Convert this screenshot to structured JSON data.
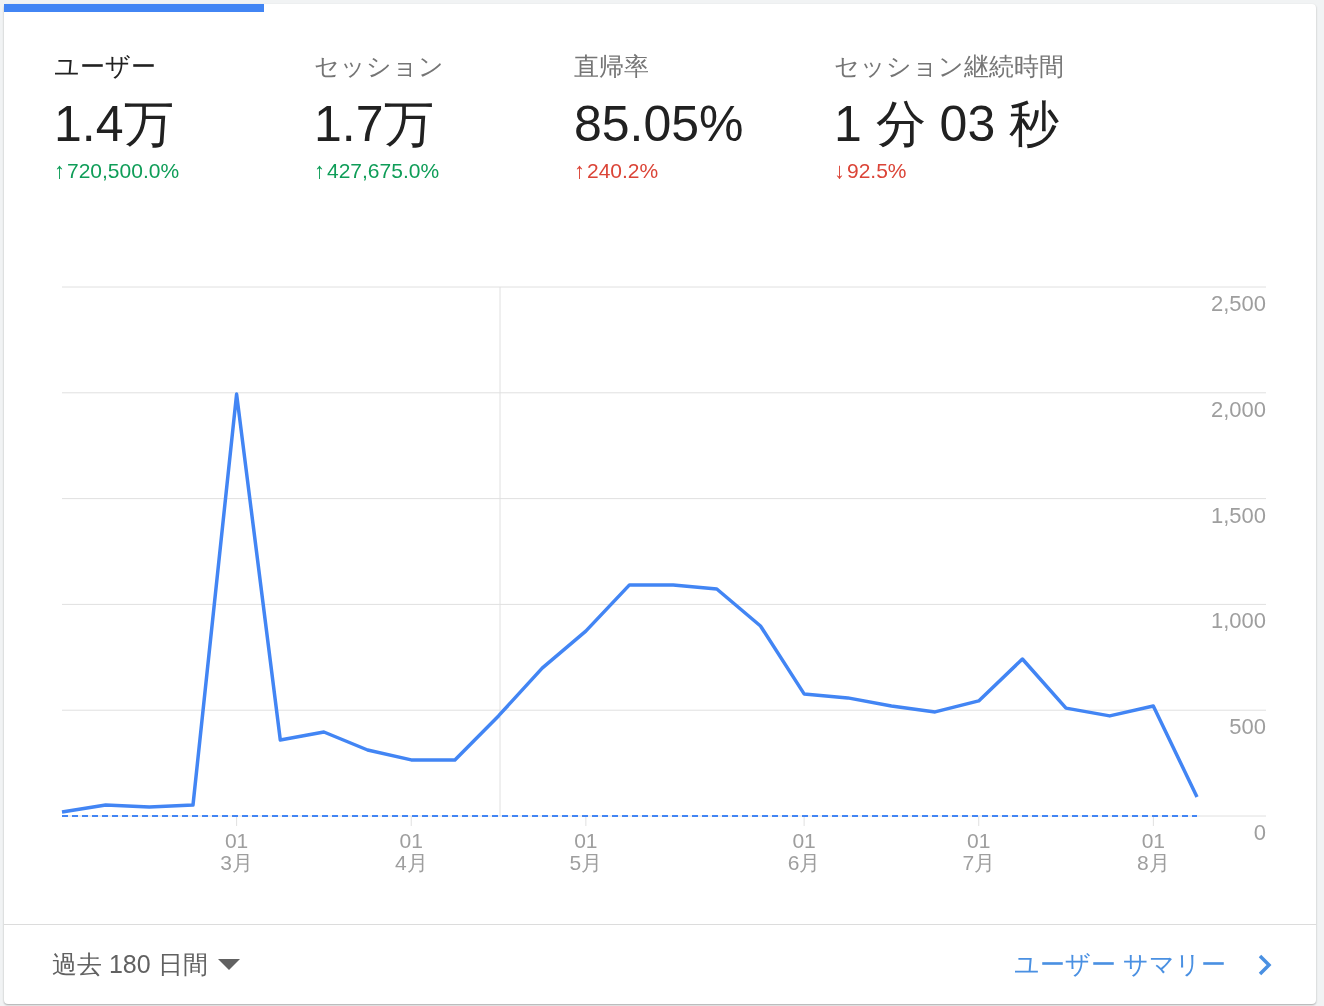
{
  "metric_tabs": [
    {
      "label": "ユーザー",
      "value": "1.4万",
      "arrow": "↑",
      "change": "720,500.0%",
      "color": "#0f9d58",
      "selected": true
    },
    {
      "label": "セッション",
      "value": "1.7万",
      "arrow": "↑",
      "change": "427,675.0%",
      "color": "#0f9d58",
      "selected": false
    },
    {
      "label": "直帰率",
      "value": "85.05%",
      "arrow": "↑",
      "change": "240.2%",
      "color": "#db4437",
      "selected": false
    },
    {
      "label": "セッション継続時間",
      "value": "1 分 03 秒",
      "arrow": "↓",
      "change": "92.5%",
      "color": "#db4437",
      "selected": false
    }
  ],
  "chart": {
    "chart_data": {
      "type": "line",
      "categories": [
        null,
        null,
        null,
        null,
        "01 3月",
        null,
        null,
        null,
        "01 4月",
        null,
        null,
        null,
        "01 5月",
        null,
        null,
        null,
        null,
        "01 6月",
        null,
        null,
        null,
        "01 7月",
        null,
        null,
        null,
        "01 8月",
        null
      ],
      "series": [
        {
          "color": "#4285f4",
          "values": [
            19,
            52,
            43,
            52,
            1994,
            359,
            397,
            312,
            265,
            265,
            473,
            699,
            874,
            1092,
            1092,
            1073,
            898,
            577,
            558,
            520,
            492,
            544,
            742,
            510,
            473,
            520,
            90
          ]
        },
        {
          "color": "#4285f4",
          "line_style": "dashed",
          "values": [
            0,
            0,
            0,
            0,
            0,
            0,
            0,
            0,
            0,
            0,
            0,
            0,
            0,
            0,
            0,
            0,
            0,
            0,
            0,
            0,
            0,
            0,
            0,
            0,
            0,
            0,
            0
          ]
        }
      ],
      "grid": true,
      "ylim": [
        0,
        2500
      ],
      "yticks": [
        {
          "value": 0,
          "label": "0"
        },
        {
          "value": 500,
          "label": "500"
        },
        {
          "value": 1000,
          "label": "1,000"
        },
        {
          "value": 1500,
          "label": "1,500"
        },
        {
          "value": 2000,
          "label": "2,000"
        },
        {
          "value": 2500,
          "label": "2,500"
        }
      ]
    }
  },
  "footer": {
    "date_range": "過去 180 日間",
    "link": "ユーザー サマリー"
  }
}
